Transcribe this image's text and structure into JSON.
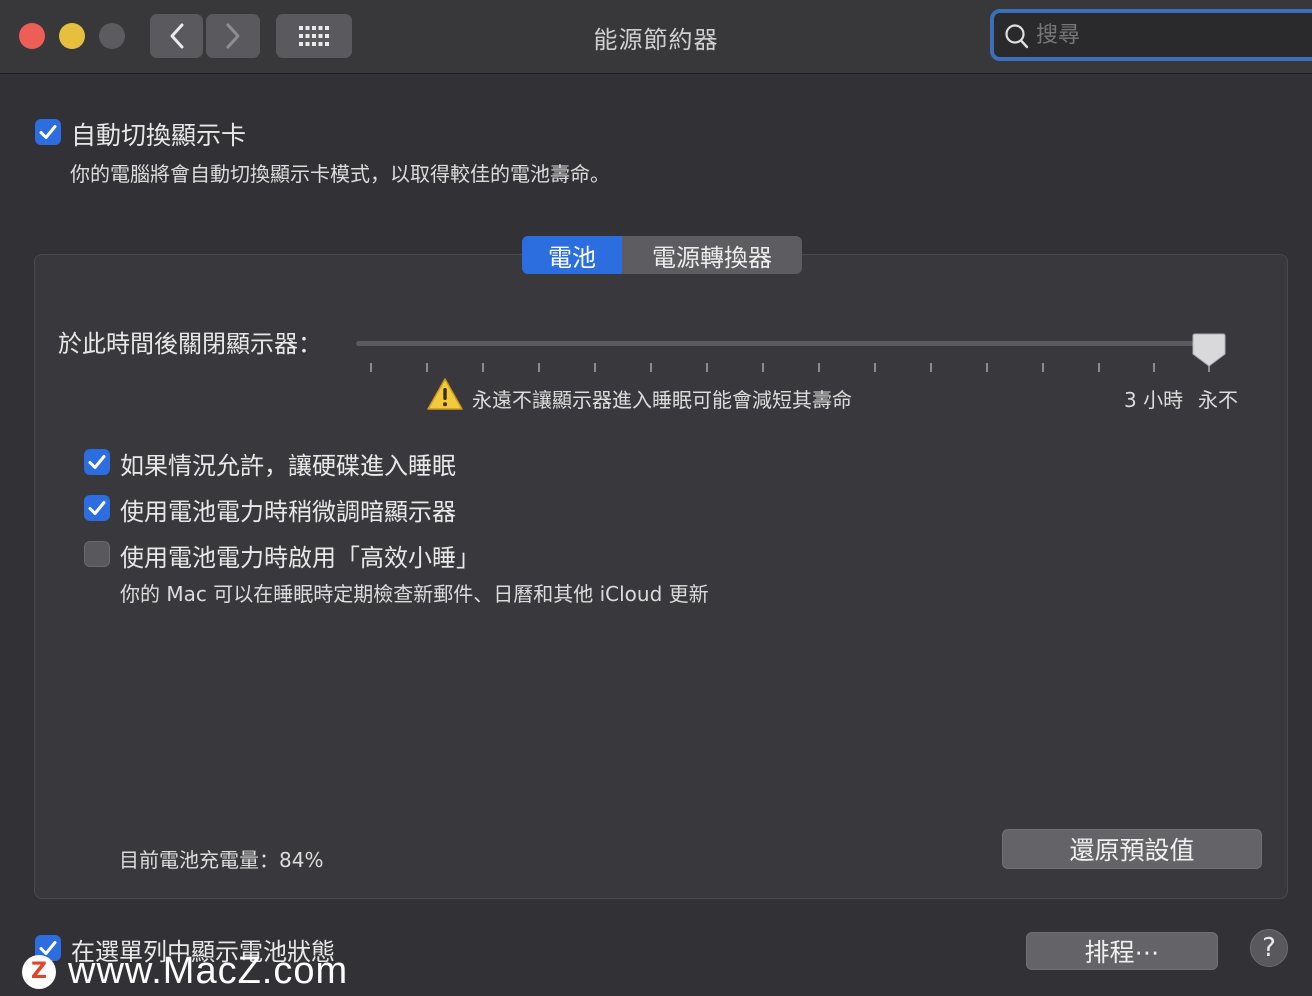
{
  "window": {
    "title": "能源節約器"
  },
  "toolbar": {
    "back": "‹",
    "forward": "›"
  },
  "search": {
    "placeholder": "搜尋"
  },
  "auto_graphics": {
    "label": "自動切換顯示卡",
    "description": "你的電腦將會自動切換顯示卡模式，以取得較佳的電池壽命。",
    "checked": true
  },
  "tabs": [
    {
      "label": "電池",
      "selected": true
    },
    {
      "label": "電源轉換器",
      "selected": false
    }
  ],
  "display_off": {
    "label": "於此時間後關閉顯示器：",
    "value_label": "永不",
    "warning": "永遠不讓顯示器進入睡眠可能會減短其壽命",
    "tick_3h": "3 小時",
    "tick_never": "永不",
    "slider_fraction": 1.0
  },
  "options": [
    {
      "label": "如果情況允許，讓硬碟進入睡眠",
      "checked": true
    },
    {
      "label": "使用電池電力時稍微調暗顯示器",
      "checked": true
    },
    {
      "label": "使用電池電力時啟用「高效小睡」",
      "checked": false,
      "description": "你的 Mac 可以在睡眠時定期檢查新郵件、日曆和其他 iCloud 更新"
    }
  ],
  "battery": {
    "level_text": "目前電池充電量：84%"
  },
  "buttons": {
    "restore_defaults": "還原預設值",
    "schedule": "排程⋯",
    "help": "?"
  },
  "menu_bar_status": {
    "label": "在選單列中顯示電池狀態",
    "checked": true
  },
  "watermark": {
    "logo": "Z",
    "text": "www.MacZ.com"
  },
  "colors": {
    "accent": "#2c6ee0",
    "background": "#323236"
  }
}
